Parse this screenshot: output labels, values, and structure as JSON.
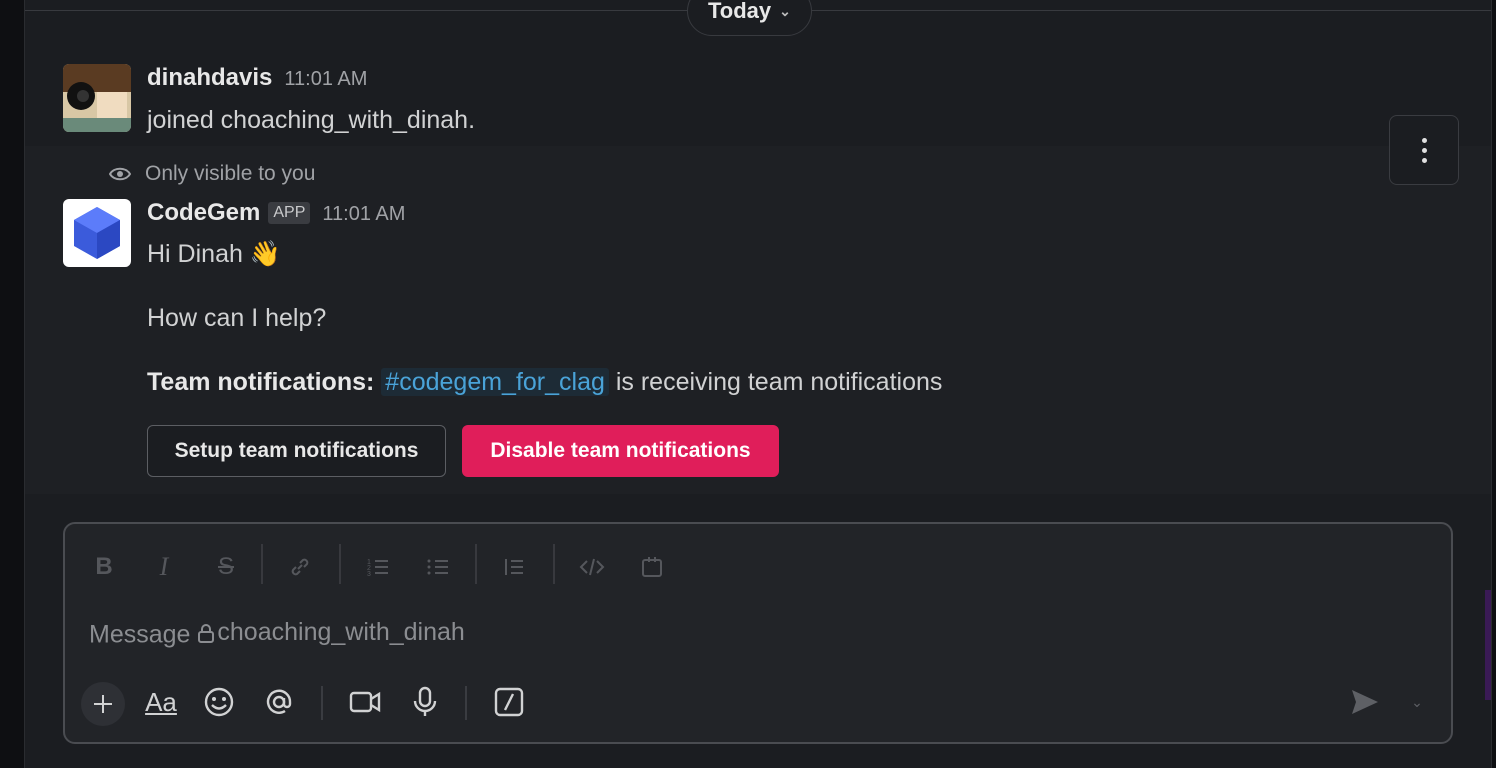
{
  "divider": {
    "label": "Today"
  },
  "messages": [
    {
      "author": "dinahdavis",
      "time": "11:01 AM",
      "text": "joined choaching_with_dinah."
    },
    {
      "ephemeral_note": "Only visible to you",
      "author": "CodeGem",
      "badge": "APP",
      "time": "11:01 AM",
      "greeting": "Hi Dinah",
      "emoji": "👋",
      "question": "How can I help?",
      "notif_label": "Team notifications:",
      "notif_channel": "#codegem_for_clag",
      "notif_suffix": "is receiving team notifications",
      "buttons": {
        "setup": "Setup team notifications",
        "disable": "Disable team notifications"
      }
    }
  ],
  "composer": {
    "placeholder_prefix": "Message",
    "placeholder_channel": "choaching_with_dinah",
    "format_toolbar": [
      "bold-icon",
      "italic-icon",
      "strikethrough-icon",
      "link-icon",
      "ordered-list-icon",
      "bulleted-list-icon",
      "blockquote-icon",
      "code-icon",
      "code-block-icon"
    ],
    "bottom_toolbar": [
      "plus-icon",
      "formatting-icon",
      "emoji-icon",
      "mention-icon",
      "video-icon",
      "microphone-icon",
      "slash-shortcut-icon",
      "send-icon",
      "chevron-down-icon"
    ],
    "format_text_label": "Aa"
  },
  "colors": {
    "background": "#1b1d21",
    "disable_button": "#e01e5a",
    "channel_link": "#4aa3d8"
  }
}
